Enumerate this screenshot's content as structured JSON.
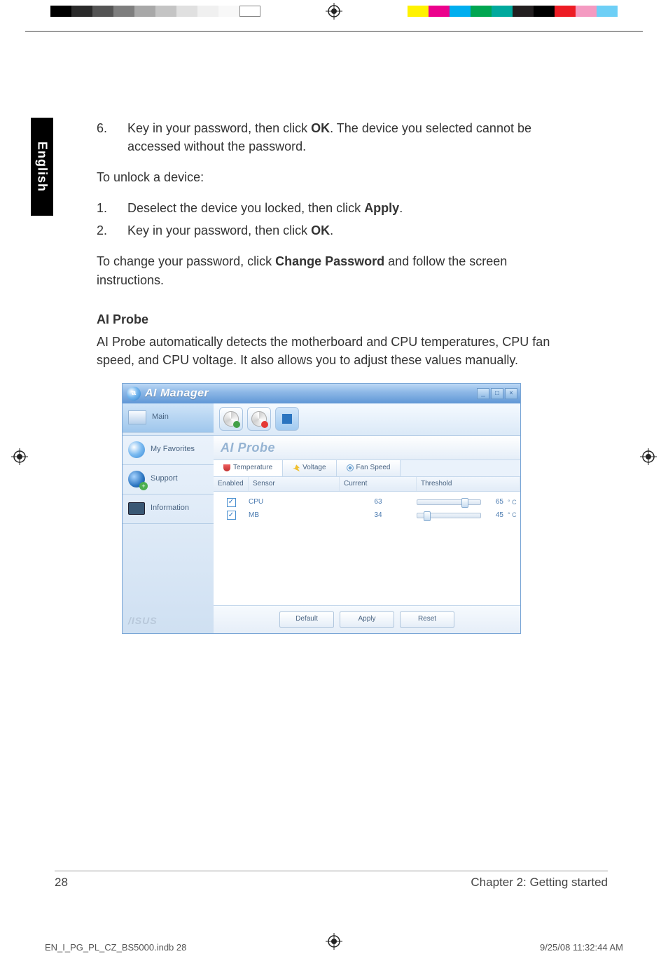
{
  "printer": {
    "gray_shades": [
      "#000000",
      "#2a2a2a",
      "#545454",
      "#7e7e7e",
      "#a8a8a8",
      "#c4c4c4",
      "#e0e0e0",
      "#f0f0f0",
      "#f8f8f8"
    ],
    "colors": [
      "#fff200",
      "#ec008c",
      "#00aeef",
      "#00a651",
      "#00a99d",
      "#231f20",
      "#000000",
      "#ed1c24",
      "#f49ac1",
      "#6dcff6"
    ]
  },
  "lang_tab": "English",
  "body": {
    "step6_num": "6.",
    "step6_a": "Key in your password, then click ",
    "step6_b": "OK",
    "step6_c": ". The device you selected cannot be accessed without the password.",
    "unlock_head": "To unlock a device:",
    "u1_num": "1.",
    "u1_a": "Deselect the device you locked, then click ",
    "u1_b": "Apply",
    "u1_c": ".",
    "u2_num": "2.",
    "u2_a": "Key in your password, then click ",
    "u2_b": "OK",
    "u2_c": ".",
    "chpw_a": "To change your password, click ",
    "chpw_b": "Change Password",
    "chpw_c": " and follow the screen instructions.",
    "probe_head": "AI Probe",
    "probe_desc": "AI Probe automatically detects the motherboard and CPU temperatures, CPU fan speed, and CPU voltage. It also allows you to adjust these values manually."
  },
  "window": {
    "title": "AI Manager",
    "nav": {
      "main": "Main",
      "fav": "My Favorites",
      "support": "Support",
      "info": "Information"
    },
    "pane_title": "AI Probe",
    "tabs": {
      "temp": "Temperature",
      "volt": "Voltage",
      "fan": "Fan Speed"
    },
    "headers": {
      "enabled": "Enabled",
      "sensor": "Sensor",
      "current": "Current",
      "threshold": "Threshold"
    },
    "rows": [
      {
        "sensor": "CPU",
        "current": "63",
        "threshold": "65",
        "unit": "° C",
        "thumb_pct": 70
      },
      {
        "sensor": "MB",
        "current": "34",
        "threshold": "45",
        "unit": "° C",
        "thumb_pct": 10
      }
    ],
    "buttons": {
      "default": "Default",
      "apply": "Apply",
      "reset": "Reset"
    },
    "brand": "/ISUS"
  },
  "footer": {
    "page": "28",
    "chapter": "Chapter 2: Getting started",
    "docfile": "EN_I_PG_PL_CZ_BS5000.indb   28",
    "datetime": "9/25/08   11:32:44 AM"
  }
}
